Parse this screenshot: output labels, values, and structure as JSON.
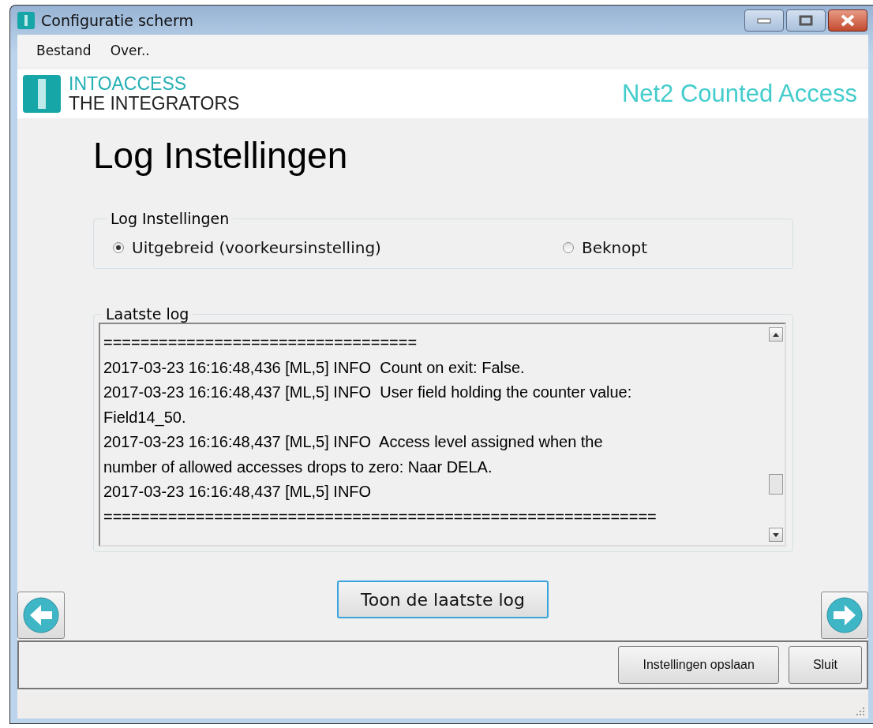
{
  "window": {
    "title": "Configuratie scherm"
  },
  "menu": [
    "Bestand",
    "Over.."
  ],
  "header": {
    "brand_line_1": "INTOACCESS",
    "brand_line_2": "THE INTEGRATORS",
    "product": "Net2 Counted Access"
  },
  "heading": "Log Instellingen",
  "settings_group": {
    "title": "Log Instellingen",
    "options": [
      {
        "label": "Uitgebreid (voorkeursinstelling)",
        "selected": true
      },
      {
        "label": "Beknopt",
        "selected": false
      }
    ]
  },
  "log_group": {
    "title": "Laatste log",
    "lines": [
      "==================================",
      "2017-03-23 16:16:48,436 [ML,5] INFO  Count on exit: False.",
      "2017-03-23 16:16:48,437 [ML,5] INFO  User field holding the counter value:",
      "Field14_50.",
      "2017-03-23 16:16:48,437 [ML,5] INFO  Access level assigned when the",
      "number of allowed accesses drops to zero: Naar DELA.",
      "2017-03-23 16:16:48,437 [ML,5] INFO",
      "============================================================"
    ]
  },
  "show_log_button": "Toon de laatste log",
  "bottom_buttons": [
    "Instellingen opslaan",
    "Sluit"
  ]
}
